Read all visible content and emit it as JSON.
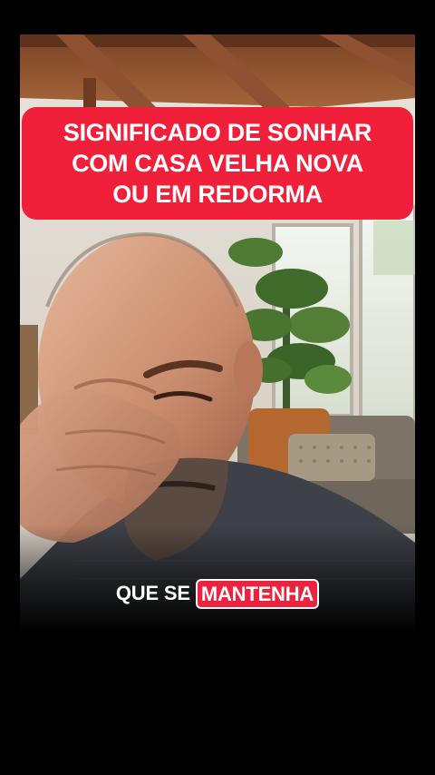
{
  "title": {
    "lines": [
      "SIGNIFICADO DE SONHAR",
      "COM CASA VELHA NOVA",
      "OU EM REDORMA"
    ]
  },
  "caption": {
    "plain": "QUE SE",
    "highlight": "MANTENHA"
  },
  "colors": {
    "banner": "#f0203a",
    "caption_highlight": "#e8243f",
    "background": "#000000"
  }
}
